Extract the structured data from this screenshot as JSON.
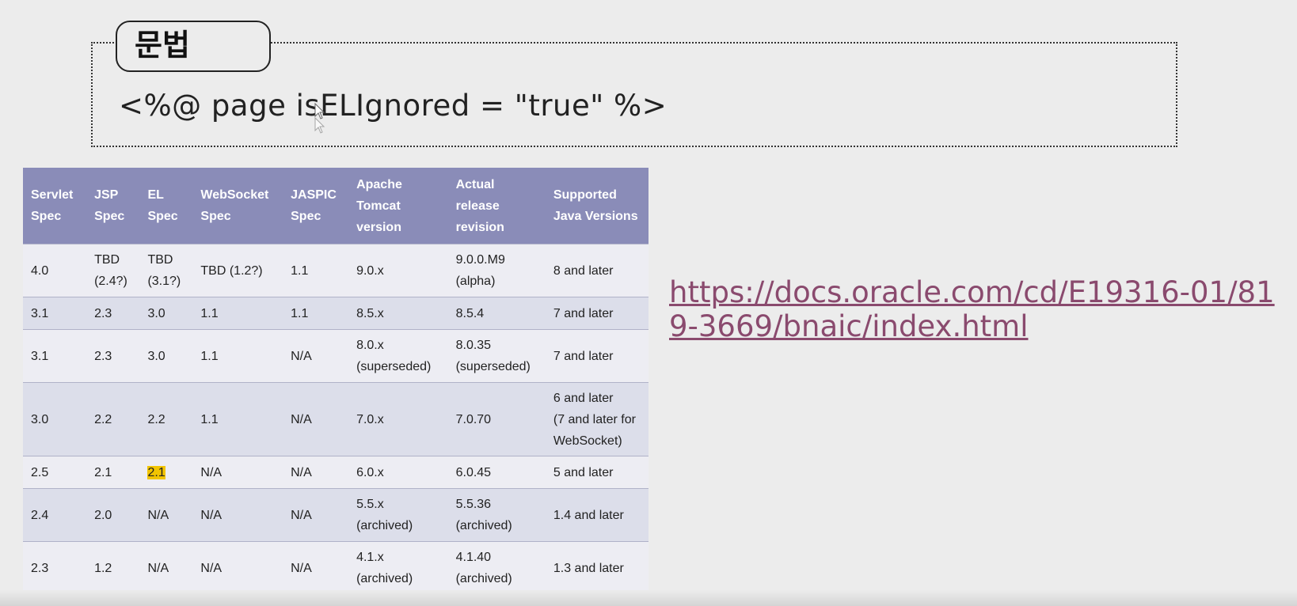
{
  "syntax": {
    "title": "문법",
    "code": "<%@ page isELIgnored = \"true\" %>"
  },
  "table": {
    "headers": [
      [
        "Servlet",
        "Spec"
      ],
      [
        "JSP",
        "Spec"
      ],
      [
        "EL",
        "Spec"
      ],
      [
        "WebSocket",
        "Spec"
      ],
      [
        "JASPIC",
        "Spec"
      ],
      [
        "Apache",
        "Tomcat",
        "version"
      ],
      [
        "Actual",
        "release",
        "revision"
      ],
      [
        "Supported",
        "Java Versions"
      ]
    ],
    "rows": [
      [
        [
          "4.0"
        ],
        [
          "TBD",
          "(2.4?)"
        ],
        [
          "TBD",
          "(3.1?)"
        ],
        [
          "TBD (1.2?)"
        ],
        [
          "1.1"
        ],
        [
          "9.0.x"
        ],
        [
          "9.0.0.M9",
          "(alpha)"
        ],
        [
          "8 and later"
        ]
      ],
      [
        [
          "3.1"
        ],
        [
          "2.3"
        ],
        [
          "3.0"
        ],
        [
          "1.1"
        ],
        [
          "1.1"
        ],
        [
          "8.5.x"
        ],
        [
          "8.5.4"
        ],
        [
          "7 and later"
        ]
      ],
      [
        [
          "3.1"
        ],
        [
          "2.3"
        ],
        [
          "3.0"
        ],
        [
          "1.1"
        ],
        [
          "N/A"
        ],
        [
          "8.0.x",
          "(superseded)"
        ],
        [
          "8.0.35",
          "(superseded)"
        ],
        [
          "7 and later"
        ]
      ],
      [
        [
          "3.0"
        ],
        [
          "2.2"
        ],
        [
          "2.2"
        ],
        [
          "1.1"
        ],
        [
          "N/A"
        ],
        [
          "7.0.x"
        ],
        [
          "7.0.70"
        ],
        [
          "6 and later",
          "(7 and later for",
          "WebSocket)"
        ]
      ],
      [
        [
          "2.5"
        ],
        [
          "2.1"
        ],
        [
          "2.1"
        ],
        [
          "N/A"
        ],
        [
          "N/A"
        ],
        [
          "6.0.x"
        ],
        [
          "6.0.45"
        ],
        [
          "5 and later"
        ]
      ],
      [
        [
          "2.4"
        ],
        [
          "2.0"
        ],
        [
          "N/A"
        ],
        [
          "N/A"
        ],
        [
          "N/A"
        ],
        [
          "5.5.x",
          "(archived)"
        ],
        [
          "5.5.36",
          "(archived)"
        ],
        [
          "1.4 and later"
        ]
      ],
      [
        [
          "2.3"
        ],
        [
          "1.2"
        ],
        [
          "N/A"
        ],
        [
          "N/A"
        ],
        [
          "N/A"
        ],
        [
          "4.1.x",
          "(archived)"
        ],
        [
          "4.1.40",
          "(archived)"
        ],
        [
          "1.3 and later"
        ]
      ]
    ],
    "highlight": {
      "row": 4,
      "col": 2,
      "color": "#f2c400"
    }
  },
  "link": {
    "text": "https://docs.oracle.com/cd/E19316-01/819-3669/bnaic/index.html",
    "color": "#8a4a6e"
  }
}
